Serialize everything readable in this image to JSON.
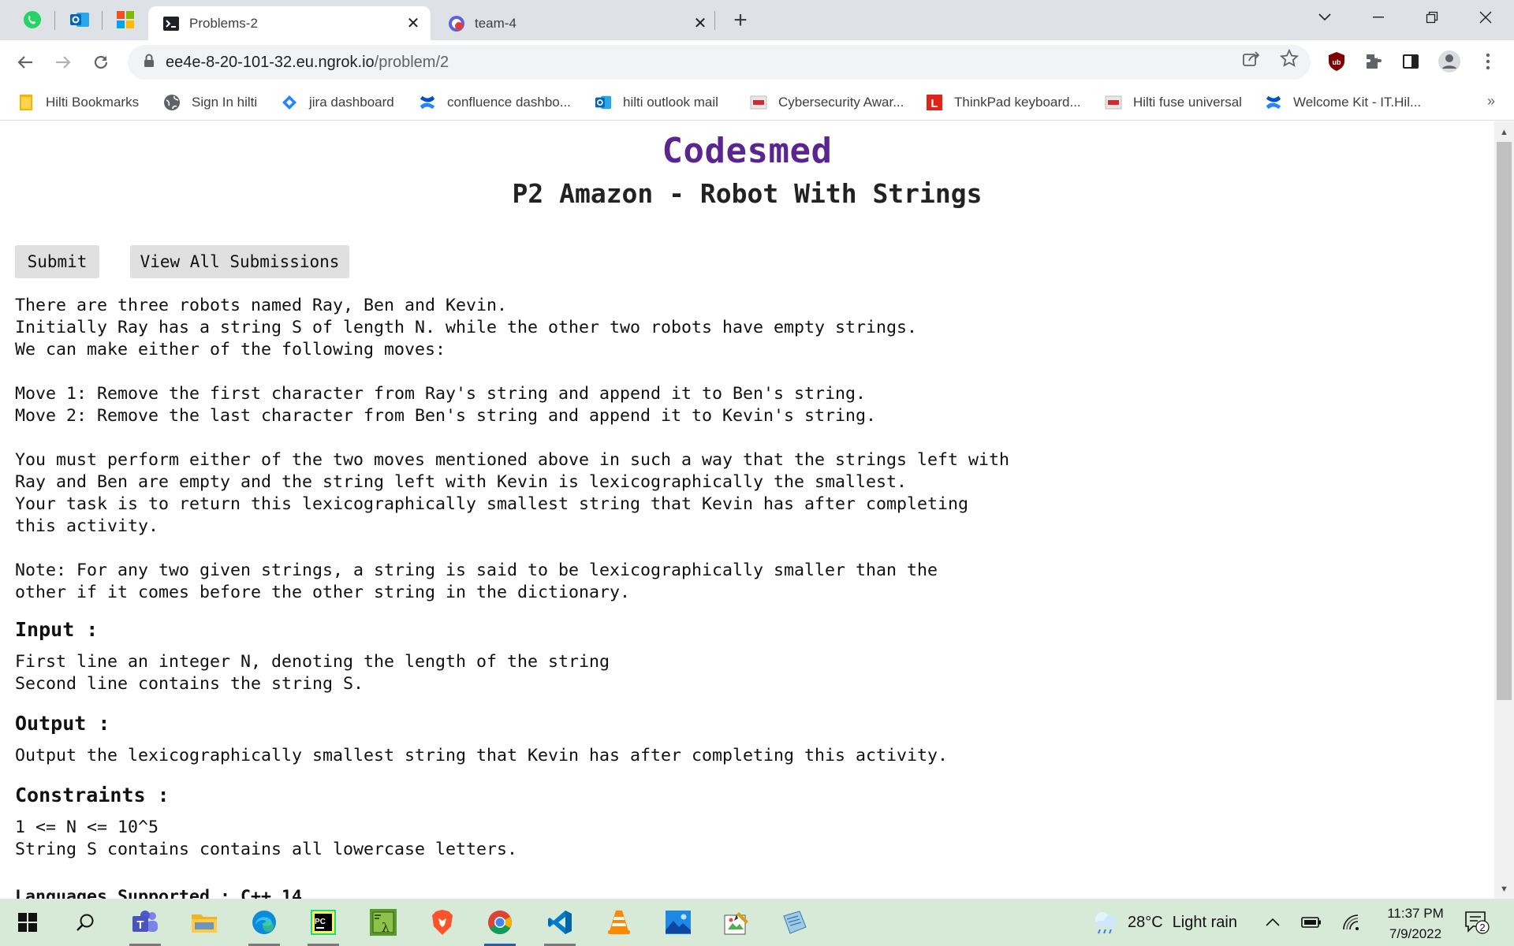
{
  "tabs": {
    "pinned": [
      "whatsapp-icon",
      "outlook-icon",
      "microsoft-icon"
    ],
    "items": [
      {
        "title": "Problems-2",
        "active": true,
        "icon": "terminal-icon"
      },
      {
        "title": "team-4",
        "active": false,
        "icon": "record-icon"
      }
    ]
  },
  "toolbar": {
    "url_host": "ee4e-8-20-101-32.eu.ngrok.io",
    "url_path": "/problem/2"
  },
  "bookmarks": {
    "items": [
      {
        "label": "Hilti Bookmarks",
        "icon": "folder-icon"
      },
      {
        "label": "Sign In hilti",
        "icon": "globe-icon"
      },
      {
        "label": "jira dashboard",
        "icon": "jira-icon"
      },
      {
        "label": "confluence dashbo...",
        "icon": "confluence-icon"
      },
      {
        "label": "hilti outlook mail",
        "icon": "outlook-icon"
      },
      {
        "label": "Cybersecurity Awar...",
        "icon": "hilti-icon"
      },
      {
        "label": "ThinkPad keyboard...",
        "icon": "lenovo-icon"
      },
      {
        "label": "Hilti fuse universal",
        "icon": "hilti-icon"
      },
      {
        "label": "Welcome Kit - IT.Hil...",
        "icon": "confluence-icon"
      }
    ],
    "more": "»"
  },
  "page": {
    "brand": "Codesmed",
    "title": "P2 Amazon - Robot With Strings",
    "submit_label": "Submit",
    "view_all_label": "View All Submissions",
    "description": "There are three robots named Ray, Ben and Kevin.\nInitially Ray has a string S of length N. while the other two robots have empty strings.\nWe can make either of the following moves:\n\nMove 1: Remove the first character from Ray's string and append it to Ben's string.\nMove 2: Remove the last character from Ben's string and append it to Kevin's string.\n\nYou must perform either of the two moves mentioned above in such a way that the strings left with\nRay and Ben are empty and the string left with Kevin is lexicographically the smallest.\nYour task is to return this lexicographically smallest string that Kevin has after completing\nthis activity.\n\nNote: For any two given strings, a string is said to be lexicographically smaller than the\nother if it comes before the other string in the dictionary.",
    "input_heading": "Input :",
    "input_text": "First line an integer N, denoting the length of the string\nSecond line contains the string S.",
    "output_heading": "Output :",
    "output_text": "Output the lexicographically smallest string that Kevin has after completing this activity.",
    "constraints_heading": "Constraints :",
    "constraints_text": "1 <= N <= 10^5\nString S contains contains all lowercase letters.",
    "languages_label": "Languages Supported : C++ 14"
  },
  "taskbar": {
    "weather_temp": "28°C",
    "weather_desc": "Light rain",
    "time": "11:37 PM",
    "date": "7/9/2022",
    "notifications": "2"
  }
}
